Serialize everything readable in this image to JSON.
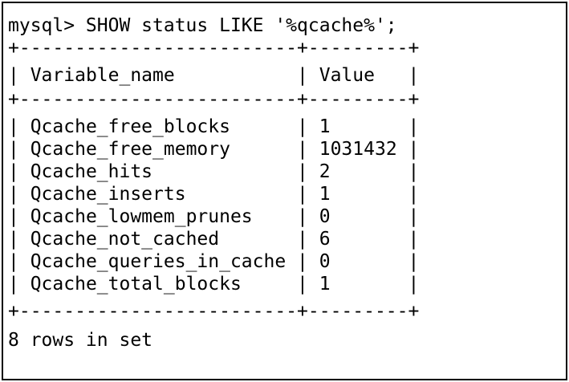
{
  "command": "mysql> SHOW status LIKE '%qcache%';",
  "table": {
    "headers": [
      "Variable_name",
      "Value"
    ],
    "rows": [
      [
        "Qcache_free_blocks",
        "1"
      ],
      [
        "Qcache_free_memory",
        "1031432"
      ],
      [
        "Qcache_hits",
        "2"
      ],
      [
        "Qcache_inserts",
        "1"
      ],
      [
        "Qcache_lowmem_prunes",
        "0"
      ],
      [
        "Qcache_not_cached",
        "6"
      ],
      [
        "Qcache_queries_in_cache",
        "0"
      ],
      [
        "Qcache_total_blocks",
        "1"
      ]
    ]
  },
  "footer": "8 rows in set"
}
